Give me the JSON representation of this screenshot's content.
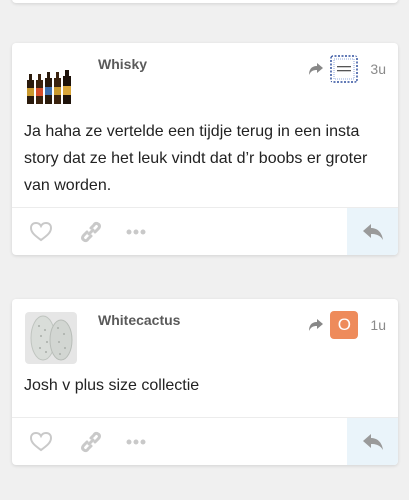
{
  "posts": [
    {
      "username": "Whisky",
      "time": "3u",
      "body": "Ja haha ze vertelde een tijdje terug in een insta story dat ze het leuk vindt dat d’r boobs er groter van worden.",
      "reply_to_avatar": "blue-pattern-avatar"
    },
    {
      "username": "Whitecactus",
      "time": "1u",
      "body": "Josh v plus size collectie",
      "reply_to_letter": "O"
    }
  ],
  "colors": {
    "reply_avatar_orange": "#ee8b5b",
    "reply_button_bg": "#eaf4fa",
    "icon_gray": "#c9c9c9"
  },
  "icons": [
    "heart-icon",
    "link-icon",
    "more-icon",
    "reply-icon",
    "reply-arrow-icon"
  ]
}
